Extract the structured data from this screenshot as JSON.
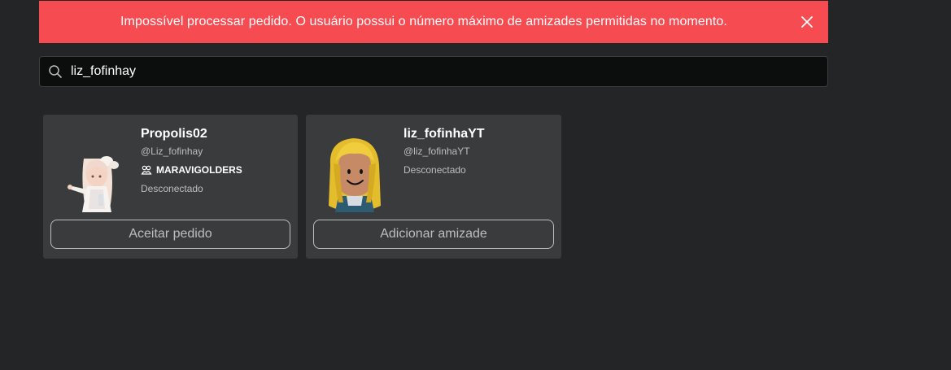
{
  "toast": {
    "message": "Impossível processar pedido. O usuário possui o número máximo de amizades permitidas no momento.",
    "color": "#f74b52"
  },
  "search": {
    "value": "liz_fofinhay"
  },
  "results": [
    {
      "display_name": "Propolis02",
      "username": "@Liz_fofinhay",
      "group": "MARAVIGOLDERS",
      "status": "Desconectado",
      "action_label": "Aceitar pedido"
    },
    {
      "display_name": "liz_fofinhaYT",
      "username": "@liz_fofinhaYT",
      "status": "Desconectado",
      "action_label": "Adicionar amizade"
    }
  ],
  "colors": {
    "background": "#232527",
    "card": "#393b3d",
    "muted_text": "#bdbebe"
  }
}
